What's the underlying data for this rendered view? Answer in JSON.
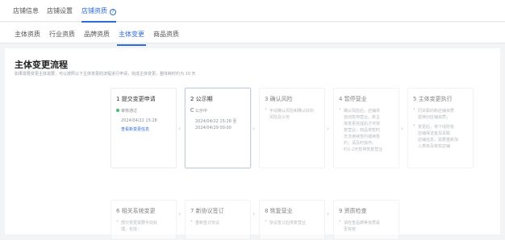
{
  "top_tabs": [
    {
      "label": "店铺信息"
    },
    {
      "label": "店铺设置"
    },
    {
      "label": "店铺资质",
      "active": true
    }
  ],
  "top_tab_help": "?",
  "sub_tabs": [
    {
      "label": "主体资质"
    },
    {
      "label": "行业资质"
    },
    {
      "label": "品牌资质"
    },
    {
      "label": "主体变更",
      "active": true
    },
    {
      "label": "商品资质"
    }
  ],
  "page": {
    "title": "主体变更流程",
    "description": "如果需要变更主体需要，可以按照以下主体变更的流程进行申请，完成主体变更，整体耗时约为 10 天"
  },
  "steps": [
    {
      "title": "1 提交变更申请",
      "status": "审核通过",
      "lines": [
        "2024/04/22 15:28"
      ],
      "link": "查看新变更信息"
    },
    {
      "title": "2 公示期",
      "status": "公示中",
      "lines": [
        "2024/04/22 15:28 至",
        "2024/04/29 00:00"
      ]
    },
    {
      "title": "3 确认风险",
      "bullets": [
        "手动确认风险和确认好的",
        "风险及义务"
      ]
    },
    {
      "title": "4 暂停营业",
      "bullets": [
        "确认风险后，店铺将",
        "自动暂停营业，新主",
        "体变更完成后才可恢",
        "复营业；商品将暂时",
        "无法继续签约或续签",
        "约；请及时操作。",
        "约1-2天暂停恢复营业"
      ]
    },
    {
      "title": "5 主体变更执行",
      "bullets": [
        "同关联的新店铺资质",
        "替换旧店铺资质；",
        "变更后，将下线所有",
        "店铺保证金及关联",
        "店铺信息，需要重新加",
        "入类目及核实店铺"
      ]
    },
    {
      "title": "6 相关系统变更",
      "bullets": [
        "部分变更需要手动处",
        "理，包括："
      ]
    },
    {
      "title": "7 新协议签订",
      "bullets": [
        "重新签订协议"
      ]
    },
    {
      "title": "8 恢复营业",
      "bullets": [
        "协议签订后恢复营业"
      ]
    },
    {
      "title": "9 资质检查",
      "bullets": [
        "请检查品牌等资质是",
        "否有效"
      ]
    }
  ],
  "arrow_glyph": "›"
}
